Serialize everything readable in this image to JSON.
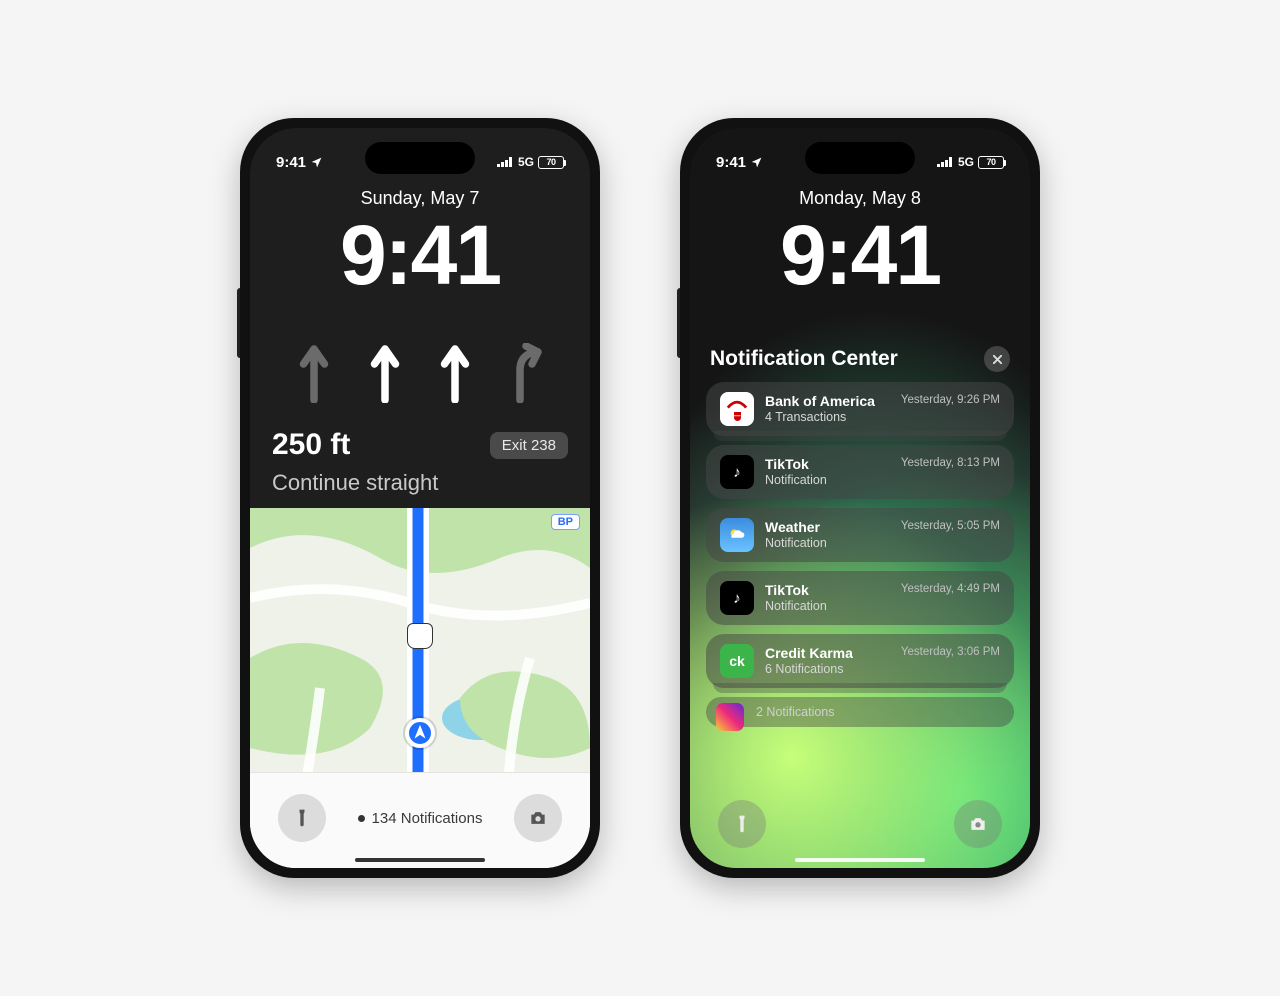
{
  "status": {
    "time": "9:41",
    "net": "5G",
    "battery": "70"
  },
  "phoneA": {
    "date": "Sunday, May 7",
    "time": "9:41",
    "nav": {
      "distance": "250 ft",
      "exit": "Exit 238",
      "instruction": "Continue straight",
      "lanes": [
        "straight-dim",
        "straight",
        "straight",
        "right-dim"
      ]
    },
    "map": {
      "poi_label": "BP"
    },
    "bottom": {
      "notifications": "134 Notifications"
    }
  },
  "phoneB": {
    "date": "Monday, May 8",
    "time": "9:41",
    "nc_title": "Notification Center",
    "items": [
      {
        "app": "Bank of America",
        "sub": "4 Transactions",
        "time": "Yesterday, 9:26 PM",
        "icon": "bofa",
        "stack": true
      },
      {
        "app": "TikTok",
        "sub": "Notification",
        "time": "Yesterday, 8:13 PM",
        "icon": "tiktok",
        "stack": false
      },
      {
        "app": "Weather",
        "sub": "Notification",
        "time": "Yesterday, 5:05 PM",
        "icon": "weather",
        "stack": false
      },
      {
        "app": "TikTok",
        "sub": "Notification",
        "time": "Yesterday, 4:49 PM",
        "icon": "tiktok",
        "stack": false
      },
      {
        "app": "Credit Karma",
        "sub": "6 Notifications",
        "time": "Yesterday, 3:06 PM",
        "icon": "ck",
        "stack": true
      }
    ],
    "peek": "2 Notifications"
  }
}
